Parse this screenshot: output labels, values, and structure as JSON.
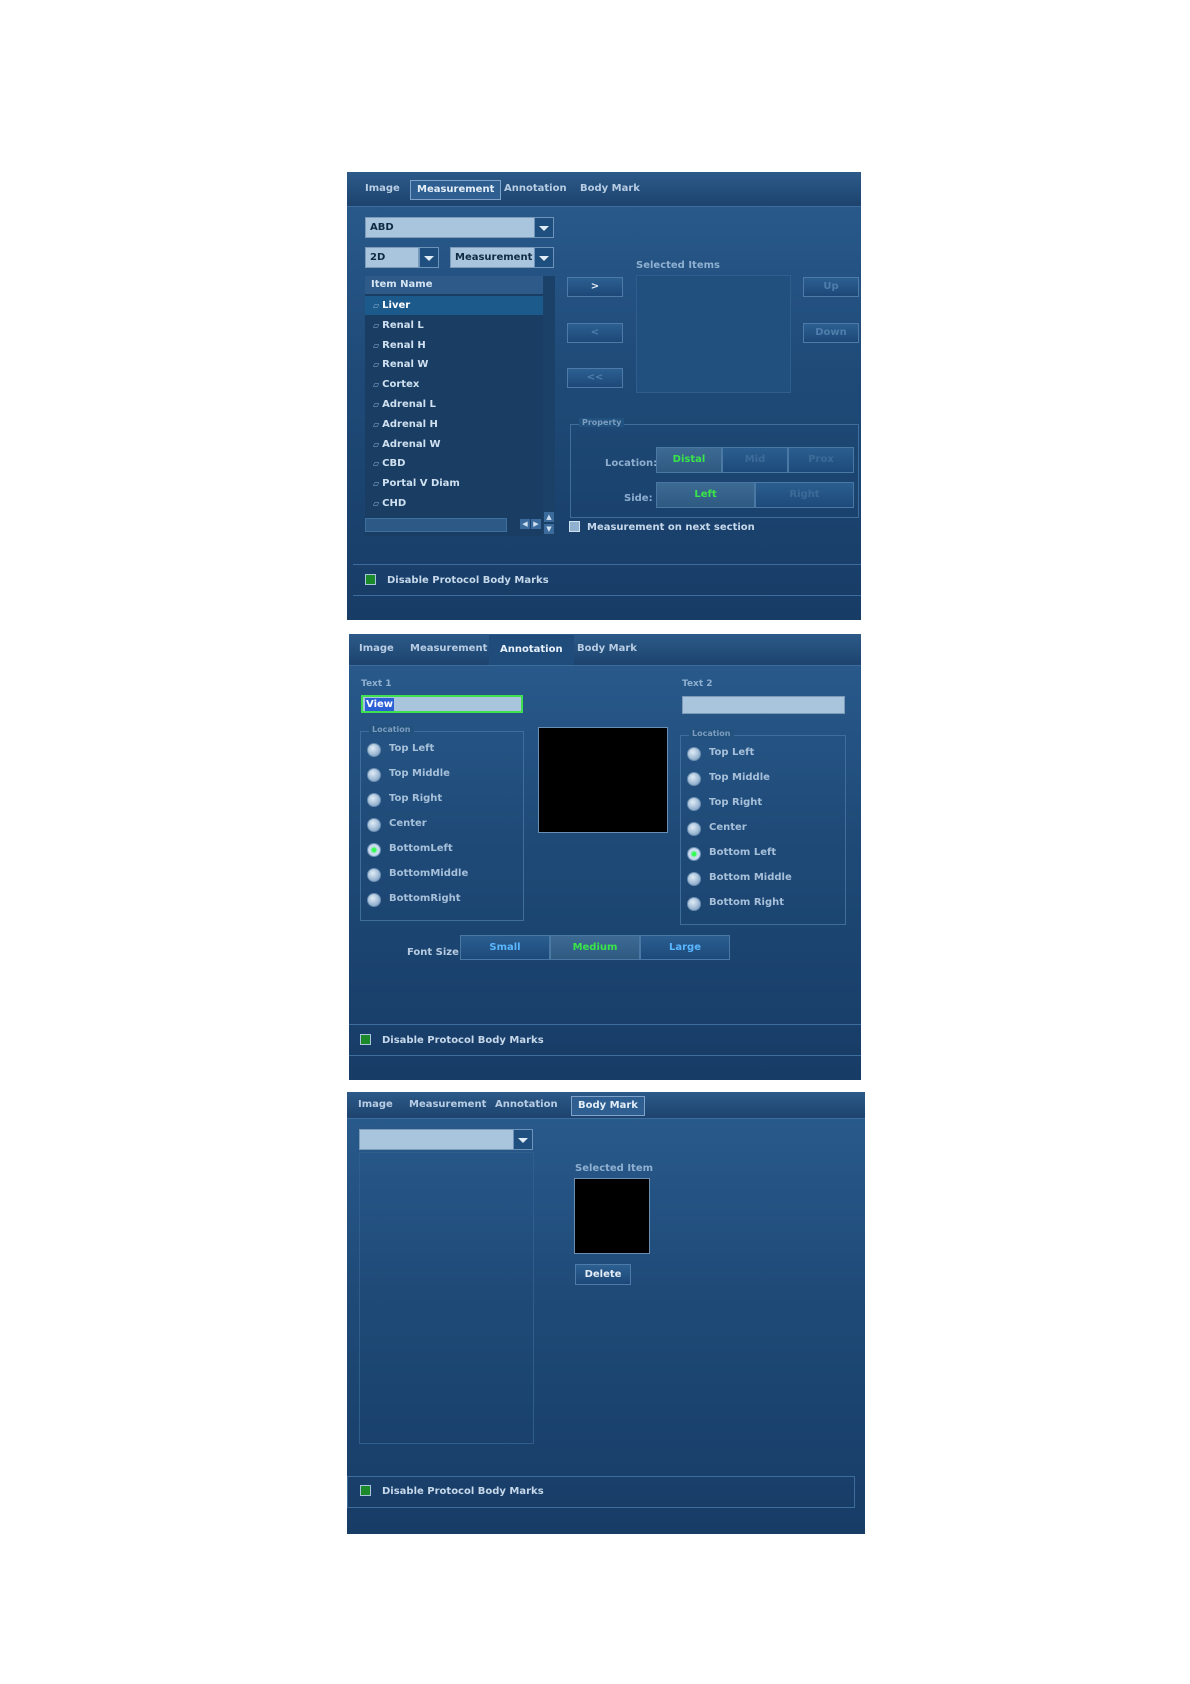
{
  "tabs": [
    "Image",
    "Measurement",
    "Annotation",
    "Body Mark"
  ],
  "disable_protocol_label": "Disable Protocol Body Marks",
  "measurement": {
    "exam": "ABD",
    "mode": "2D",
    "type": "Measurement",
    "item_header": "Item Name",
    "items": [
      "Liver",
      "Renal L",
      "Renal H",
      "Renal W",
      "Cortex",
      "Adrenal L",
      "Adrenal H",
      "Adrenal W",
      "CBD",
      "Portal V Diam",
      "CHD"
    ],
    "selected_item": "Liver",
    "add_label": ">",
    "remove_label": "<",
    "remove_all_label": "<<",
    "selected_items_label": "Selected Items",
    "up_label": "Up",
    "down_label": "Down",
    "property_label": "Property",
    "location_label": "Location:",
    "location_options": [
      "Distal",
      "Mid",
      "Prox"
    ],
    "location_selected": "Distal",
    "side_label": "Side:",
    "side_options": [
      "Left",
      "Right"
    ],
    "side_selected": "Left",
    "next_section_label": "Measurement on next section"
  },
  "annotation": {
    "text1_label": "Text 1",
    "text1_value": "View",
    "text2_label": "Text 2",
    "text2_value": "",
    "location_label": "Location",
    "locations": [
      "Top Left",
      "Top Middle",
      "Top Right",
      "Center",
      "Bottom Left",
      "Bottom Middle",
      "Bottom Right"
    ],
    "locations_left": [
      "Top Left",
      "Top Middle",
      "Top Right",
      "Center",
      "BottomLeft",
      "BottomMiddle",
      "BottomRight"
    ],
    "selected_location": "Bottom Left",
    "font_size_label": "Font Size:",
    "font_sizes": [
      "Small",
      "Medium",
      "Large"
    ],
    "font_size_selected": "Medium"
  },
  "body_mark": {
    "dropdown_value": "",
    "selected_item_label": "Selected Item",
    "delete_label": "Delete"
  },
  "colors": {
    "panel": "#1f4a78",
    "field": "#a9c4dd",
    "selected_green": "#39e548",
    "segment_blue": "#59b7ff"
  }
}
